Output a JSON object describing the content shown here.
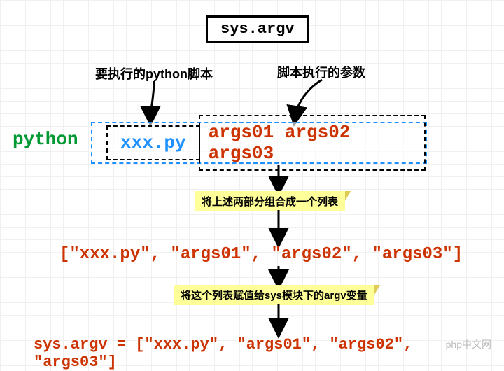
{
  "title": "sys.argv",
  "annotations": {
    "left": "要执行的python脚本",
    "right": "脚本执行的参数"
  },
  "command": {
    "interpreter": "python",
    "script": "xxx.py",
    "args": "args01 args02 args03"
  },
  "notes": {
    "combine": "将上述两部分组合成一个列表",
    "assign": "将这个列表赋值给sys模块下的argv变量"
  },
  "outputs": {
    "list": "[\"xxx.py\", \"args01\", \"args02\", \"args03\"]",
    "final": "sys.argv = [\"xxx.py\", \"args01\", \"args02\", \"args03\"]"
  },
  "watermark": "php中文网"
}
